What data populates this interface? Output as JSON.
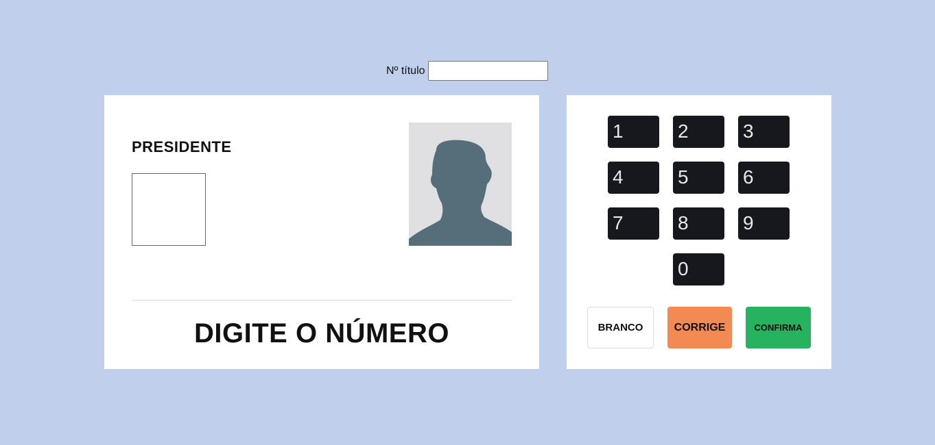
{
  "header": {
    "titulo_label": "Nº título",
    "titulo_value": ""
  },
  "screen": {
    "cargo": "PRESIDENTE",
    "instruction": "DIGITE O NÚMERO",
    "photo_icon": "person-silhouette-icon"
  },
  "keypad": {
    "keys": [
      "1",
      "2",
      "3",
      "4",
      "5",
      "6",
      "7",
      "8",
      "9",
      "0"
    ],
    "branco": "BRANCO",
    "corrige": "CORRIGE",
    "confirma": "CONFIRMA"
  },
  "colors": {
    "background": "#c0cfeb",
    "key": "#16181d",
    "corrige": "#f38a54",
    "confirma": "#27b25f",
    "silhouette": "#566e7a"
  }
}
